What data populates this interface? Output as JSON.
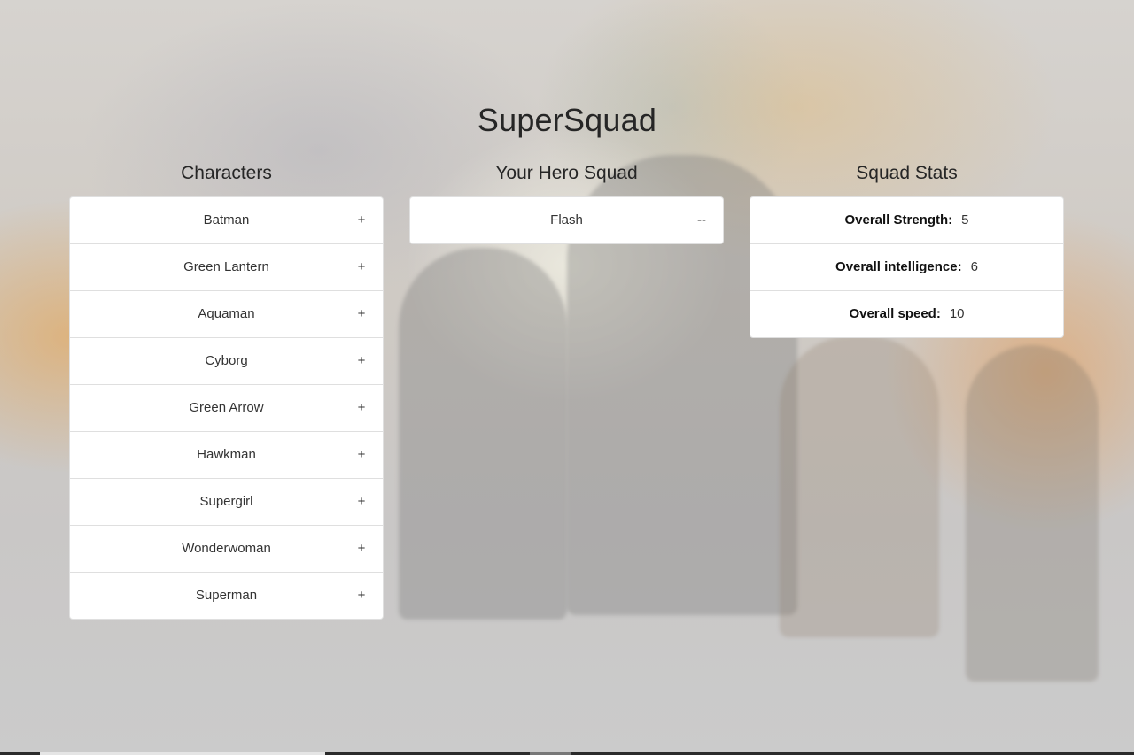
{
  "app": {
    "title": "SuperSquad"
  },
  "characters": {
    "heading": "Characters",
    "add_symbol": "+",
    "items": [
      {
        "name": "Batman"
      },
      {
        "name": "Green Lantern"
      },
      {
        "name": "Aquaman"
      },
      {
        "name": "Cyborg"
      },
      {
        "name": "Green Arrow"
      },
      {
        "name": "Hawkman"
      },
      {
        "name": "Supergirl"
      },
      {
        "name": "Wonderwoman"
      },
      {
        "name": "Superman"
      }
    ]
  },
  "squad": {
    "heading": "Your Hero Squad",
    "remove_symbol": "--",
    "items": [
      {
        "name": "Flash"
      }
    ]
  },
  "stats": {
    "heading": "Squad Stats",
    "items": [
      {
        "label": "Overall Strength:",
        "value": "5"
      },
      {
        "label": "Overall intelligence:",
        "value": "6"
      },
      {
        "label": "Overall speed:",
        "value": "10"
      }
    ]
  }
}
